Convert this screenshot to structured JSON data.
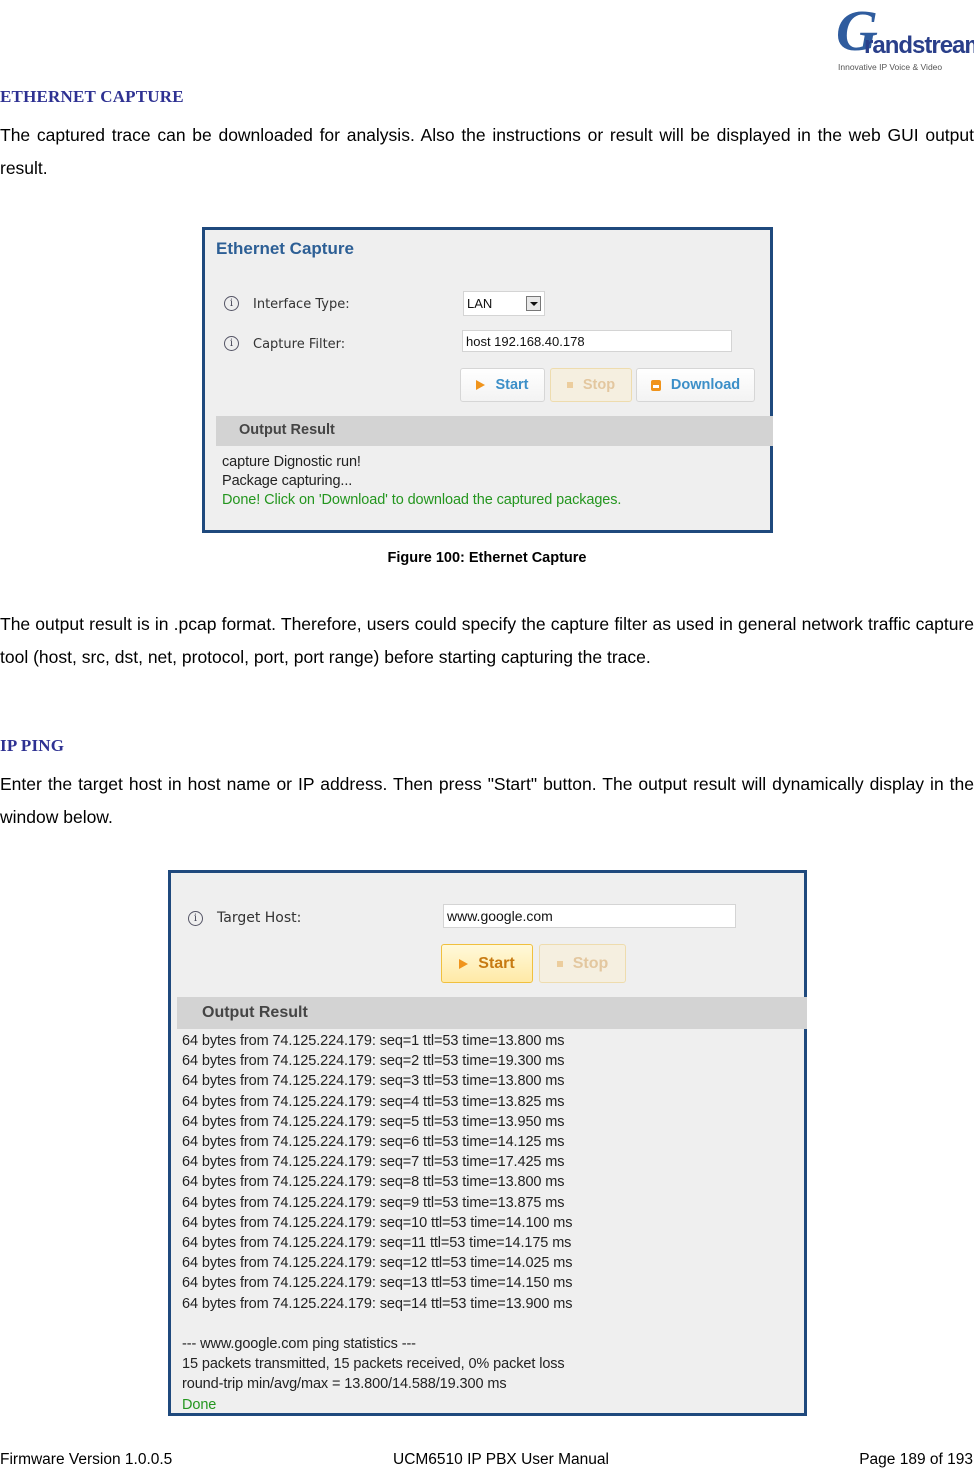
{
  "logo": {
    "brand": "Grandstream",
    "initial": "G",
    "word": "randstream",
    "tagline": "Innovative IP Voice & Video"
  },
  "sections": {
    "ethernet": {
      "heading": "ETHERNET CAPTURE",
      "intro": "The captured trace can be downloaded for analysis. Also the instructions or result will be displayed in the web GUI output result.",
      "caption": "Figure 100: Ethernet Capture",
      "after": "The output result is in .pcap format. Therefore, users could specify the capture filter as used in general network traffic capture tool (host, src, dst, net, protocol, port, port range) before starting capturing the trace."
    },
    "ping": {
      "heading": "IP PING",
      "intro": "Enter the target host in host name or IP address. Then press \"Start\" button. The output result will dynamically display in the window below."
    }
  },
  "capture_panel": {
    "title": "Ethernet Capture",
    "interface_label": "Interface Type:",
    "interface_value": "LAN",
    "filter_label": "Capture Filter:",
    "filter_value": "host 192.168.40.178",
    "buttons": {
      "start": "Start",
      "stop": "Stop",
      "download": "Download"
    },
    "output_header": "Output Result",
    "output_lines": [
      {
        "text": "capture Dignostic run!",
        "status": "normal"
      },
      {
        "text": "Package capturing...",
        "status": "normal"
      },
      {
        "text": "Done! Click on 'Download' to download the captured packages.",
        "status": "success"
      }
    ]
  },
  "ping_panel": {
    "target_label": "Target Host:",
    "target_value": "www.google.com",
    "buttons": {
      "start": "Start",
      "stop": "Stop"
    },
    "output_header": "Output Result",
    "output_lines": [
      "64 bytes from 74.125.224.179: seq=1 ttl=53 time=13.800 ms",
      "64 bytes from 74.125.224.179: seq=2 ttl=53 time=19.300 ms",
      "64 bytes from 74.125.224.179: seq=3 ttl=53 time=13.800 ms",
      "64 bytes from 74.125.224.179: seq=4 ttl=53 time=13.825 ms",
      "64 bytes from 74.125.224.179: seq=5 ttl=53 time=13.950 ms",
      "64 bytes from 74.125.224.179: seq=6 ttl=53 time=14.125 ms",
      "64 bytes from 74.125.224.179: seq=7 ttl=53 time=17.425 ms",
      "64 bytes from 74.125.224.179: seq=8 ttl=53 time=13.800 ms",
      "64 bytes from 74.125.224.179: seq=9 ttl=53 time=13.875 ms",
      "64 bytes from 74.125.224.179: seq=10 ttl=53 time=14.100 ms",
      "64 bytes from 74.125.224.179: seq=11 ttl=53 time=14.175 ms",
      "64 bytes from 74.125.224.179: seq=12 ttl=53 time=14.025 ms",
      "64 bytes from 74.125.224.179: seq=13 ttl=53 time=14.150 ms",
      "64 bytes from 74.125.224.179: seq=14 ttl=53 time=13.900 ms"
    ],
    "stats_lines": [
      "--- www.google.com ping statistics ---",
      "15 packets transmitted, 15 packets received, 0% packet loss",
      "round-trip min/avg/max = 13.800/14.588/19.300 ms"
    ],
    "done": "Done"
  },
  "footer": {
    "firmware": "Firmware Version 1.0.0.5",
    "manual": "UCM6510 IP PBX User Manual",
    "page": "Page 189 of 193"
  },
  "colors": {
    "heading": "#2e3192",
    "panel_border": "#1f497d",
    "panel_title": "#2d5f95",
    "success_text": "#24961f",
    "button_text": "#3c8fc8",
    "icon_orange": "#f0941c"
  }
}
